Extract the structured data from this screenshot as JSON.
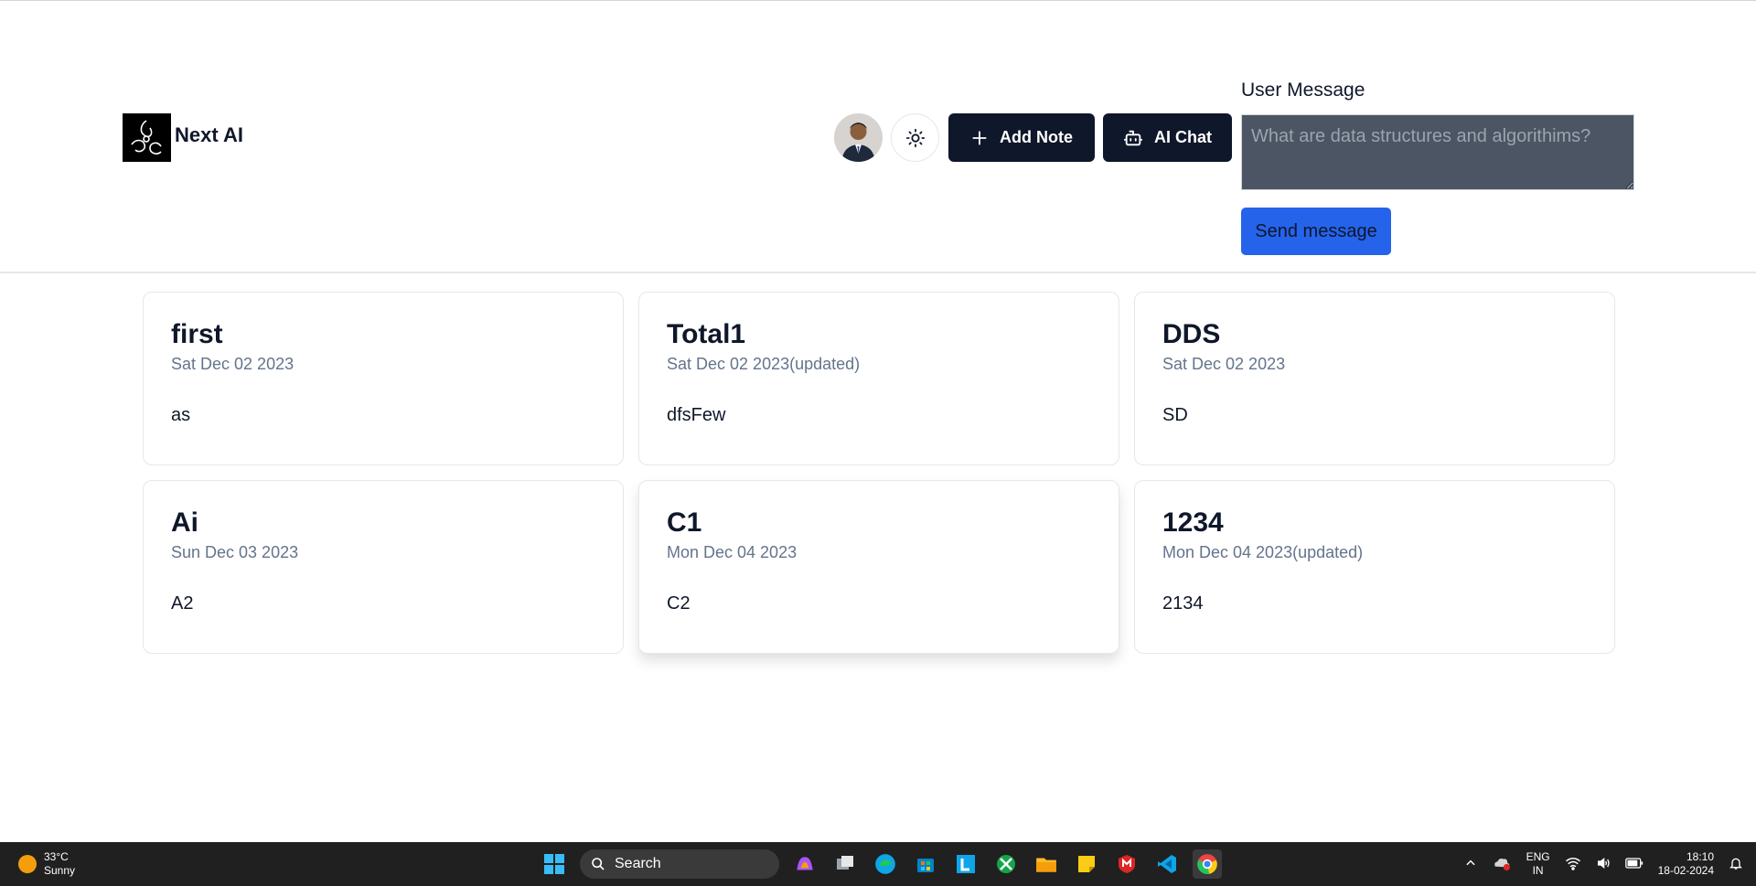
{
  "app": {
    "name": "Next AI"
  },
  "header": {
    "add_note_label": "Add Note",
    "ai_chat_label": "AI Chat",
    "user_message_label": "User Message",
    "user_message_placeholder": "What are data structures and algorithims?",
    "send_label": "Send message"
  },
  "notes": [
    {
      "title": "first",
      "date": "Sat Dec 02 2023",
      "content": "as"
    },
    {
      "title": "Total1",
      "date": "Sat Dec 02 2023(updated)",
      "content": "dfsFew"
    },
    {
      "title": "DDS",
      "date": "Sat Dec 02 2023",
      "content": "SD"
    },
    {
      "title": "Ai",
      "date": "Sun Dec 03 2023",
      "content": "A2"
    },
    {
      "title": "C1",
      "date": "Mon Dec 04 2023",
      "content": "C2"
    },
    {
      "title": "1234",
      "date": "Mon Dec 04 2023(updated)",
      "content": "2134"
    }
  ],
  "taskbar": {
    "weather_temp": "33°C",
    "weather_desc": "Sunny",
    "search_label": "Search",
    "lang_top": "ENG",
    "lang_bottom": "IN",
    "time": "18:10",
    "date": "18-02-2024"
  },
  "colors": {
    "primary_dark": "#0f172a",
    "accent_blue": "#2563eb",
    "textarea_bg": "#4b5563"
  }
}
